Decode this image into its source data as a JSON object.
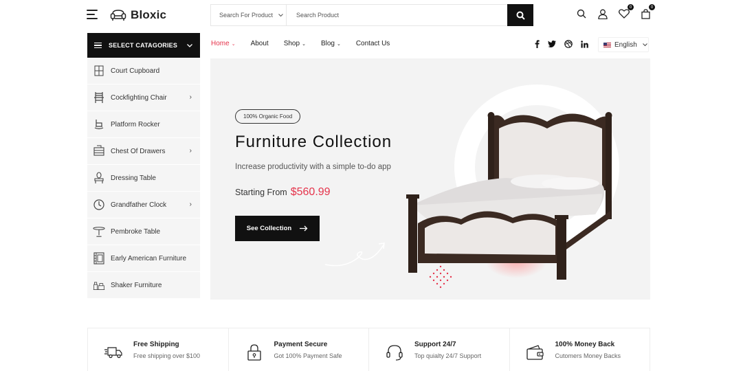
{
  "header": {
    "brand": "Bloxic",
    "search_category": "Search For Product",
    "search_placeholder": "Search Product",
    "wishlist_count": "0",
    "cart_count": "0"
  },
  "categories": {
    "heading": "SELECT CATAGORIES",
    "items": [
      {
        "label": "Court Cupboard",
        "icon": "cupboard-icon",
        "has_submenu": false
      },
      {
        "label": "Cockfighting Chair",
        "icon": "chair-icon",
        "has_submenu": true
      },
      {
        "label": "Platform Rocker",
        "icon": "rocker-icon",
        "has_submenu": false
      },
      {
        "label": "Chest Of Drawers",
        "icon": "drawers-icon",
        "has_submenu": true
      },
      {
        "label": "Dressing Table",
        "icon": "dressing-table-icon",
        "has_submenu": false
      },
      {
        "label": "Grandfather Clock",
        "icon": "clock-icon",
        "has_submenu": true
      },
      {
        "label": "Pembroke Table",
        "icon": "table-icon",
        "has_submenu": false
      },
      {
        "label": "Early American Furniture",
        "icon": "cabinet-icon",
        "has_submenu": false
      },
      {
        "label": "Shaker Furniture",
        "icon": "shaker-furniture-icon",
        "has_submenu": false
      }
    ]
  },
  "nav": {
    "items": [
      {
        "label": "Home",
        "dropdown": true,
        "active": true
      },
      {
        "label": "About",
        "dropdown": false,
        "active": false
      },
      {
        "label": "Shop",
        "dropdown": true,
        "active": false
      },
      {
        "label": "Blog",
        "dropdown": true,
        "active": false
      },
      {
        "label": "Contact Us",
        "dropdown": false,
        "active": false
      }
    ],
    "language": "English"
  },
  "hero": {
    "tag": "100% Organic Food",
    "title": "Furniture Collection",
    "subtitle": "Increase productivity with a simple to-do app",
    "price_label": "Starting From",
    "price_value": "$560.99",
    "button": "See Collection"
  },
  "features": [
    {
      "title": "Free Shipping",
      "subtitle": "Free shipping over $100",
      "icon": "truck-icon"
    },
    {
      "title": "Payment Secure",
      "subtitle": "Got 100% Payment Safe",
      "icon": "lock-icon"
    },
    {
      "title": "Support 24/7",
      "subtitle": "Top quialty 24/7 Support",
      "icon": "headset-icon"
    },
    {
      "title": "100% Money Back",
      "subtitle": "Cutomers Money Backs",
      "icon": "wallet-icon"
    }
  ],
  "colors": {
    "accent": "#e5334b",
    "dark": "#111111",
    "hero_bg": "#f3f3f3"
  }
}
